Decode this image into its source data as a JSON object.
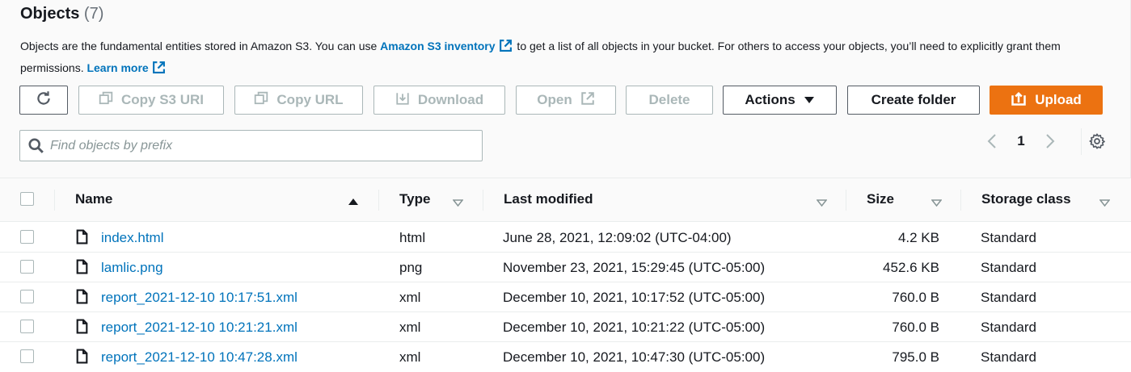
{
  "header": {
    "title": "Objects",
    "count": "(7)",
    "desc_part1": "Objects are the fundamental entities stored in Amazon S3. You can use ",
    "inventory_link": "Amazon S3 inventory",
    "desc_part2": " to get a list of all objects in your bucket. For others to access your objects, you’ll need to explicitly grant them permissions. ",
    "learn_more": "Learn more"
  },
  "toolbar": {
    "copy_s3_uri": "Copy S3 URI",
    "copy_url": "Copy URL",
    "download": "Download",
    "open": "Open",
    "delete": "Delete",
    "actions": "Actions",
    "create_folder": "Create folder",
    "upload": "Upload"
  },
  "search": {
    "placeholder": "Find objects by prefix",
    "value": ""
  },
  "pagination": {
    "current_page": "1"
  },
  "table": {
    "columns": {
      "name": "Name",
      "type": "Type",
      "last_modified": "Last modified",
      "size": "Size",
      "storage_class": "Storage class"
    },
    "rows": [
      {
        "name": "index.html",
        "type": "html",
        "last_modified": "June 28, 2021, 12:09:02 (UTC-04:00)",
        "size": "4.2 KB",
        "storage_class": "Standard"
      },
      {
        "name": "lamlic.png",
        "type": "png",
        "last_modified": "November 23, 2021, 15:29:45 (UTC-05:00)",
        "size": "452.6 KB",
        "storage_class": "Standard"
      },
      {
        "name": "report_2021-12-10 10:17:51.xml",
        "type": "xml",
        "last_modified": "December 10, 2021, 10:17:52 (UTC-05:00)",
        "size": "760.0 B",
        "storage_class": "Standard"
      },
      {
        "name": "report_2021-12-10 10:21:21.xml",
        "type": "xml",
        "last_modified": "December 10, 2021, 10:21:22 (UTC-05:00)",
        "size": "760.0 B",
        "storage_class": "Standard"
      },
      {
        "name": "report_2021-12-10 10:47:28.xml",
        "type": "xml",
        "last_modified": "December 10, 2021, 10:47:30 (UTC-05:00)",
        "size": "795.0 B",
        "storage_class": "Standard"
      }
    ]
  },
  "colors": {
    "link": "#0073bb",
    "primary": "#ec7211",
    "disabled": "#aab7b8",
    "text": "#16191f"
  },
  "icons": [
    "refresh-icon",
    "copy-icon",
    "download-icon",
    "external-link-icon",
    "caret-down-icon",
    "upload-icon",
    "search-icon",
    "chevron-left-icon",
    "chevron-right-icon",
    "gear-icon",
    "sort-ascending-icon",
    "sort-caret-icon",
    "file-icon"
  ]
}
